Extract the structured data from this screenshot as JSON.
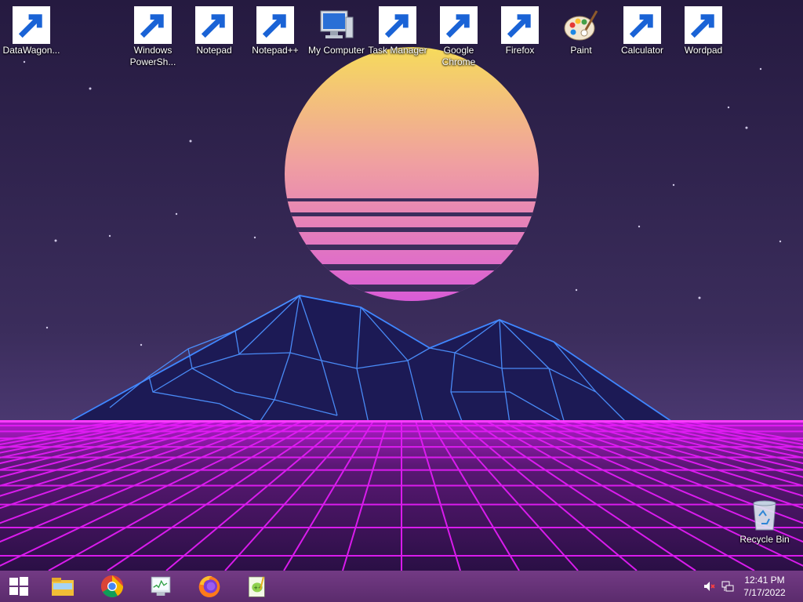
{
  "desktop": {
    "icons": [
      {
        "label": "DataWagon...",
        "icon": "datawagon-logo-icon"
      },
      {
        "label": "Windows PowerSh...",
        "icon": "powershell-icon"
      },
      {
        "label": "Notepad",
        "icon": "notepad-icon"
      },
      {
        "label": "Notepad++",
        "icon": "notepad-plus-plus-icon"
      },
      {
        "label": "My Computer",
        "icon": "computer-icon"
      },
      {
        "label": "Task Manager",
        "icon": "task-manager-icon"
      },
      {
        "label": "Google Chrome",
        "icon": "chrome-icon"
      },
      {
        "label": "Firefox",
        "icon": "firefox-icon"
      },
      {
        "label": "Paint",
        "icon": "paint-icon"
      },
      {
        "label": "Calculator",
        "icon": "calculator-icon"
      },
      {
        "label": "Wordpad",
        "icon": "wordpad-icon"
      },
      {
        "label": "Recycle Bin",
        "icon": "recycle-bin-icon"
      }
    ]
  },
  "taskbar": {
    "start": "windows-logo-icon",
    "pinned": [
      "file-explorer-icon",
      "chrome-icon",
      "task-manager-icon",
      "firefox-icon",
      "notepad-plus-plus-icon"
    ],
    "tray": [
      "volume-muted-icon",
      "network-icon"
    ],
    "clock": {
      "time": "12:41 PM",
      "date": "7/17/2022"
    }
  },
  "colors": {
    "accent": "#ff00ff",
    "grid": "#d91cf0",
    "mountain": "#2f6cff",
    "sky": "#2a1f4d"
  }
}
